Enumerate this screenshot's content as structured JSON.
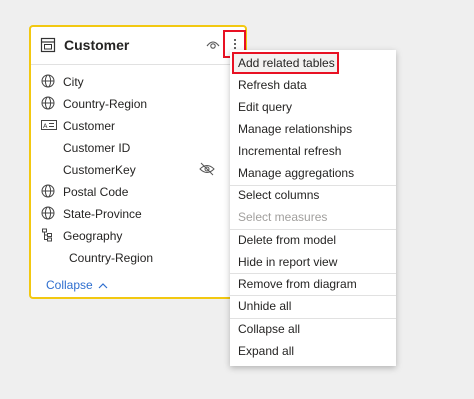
{
  "card": {
    "title": "Customer",
    "fields": [
      {
        "label": "City",
        "icon": "globe-icon"
      },
      {
        "label": "Country-Region",
        "icon": "globe-icon"
      },
      {
        "label": "Customer",
        "icon": "text-field-icon"
      },
      {
        "label": "Customer ID",
        "icon": ""
      },
      {
        "label": "CustomerKey",
        "icon": "",
        "hidden": true
      },
      {
        "label": "Postal Code",
        "icon": "globe-icon"
      },
      {
        "label": "State-Province",
        "icon": "globe-icon"
      },
      {
        "label": "Geography",
        "icon": "hierarchy-icon"
      },
      {
        "label": "Country-Region",
        "icon": "",
        "indent": true
      }
    ],
    "collapse_label": "Collapse"
  },
  "menu": {
    "items": [
      {
        "label": "Add related tables",
        "highlighted": true
      },
      {
        "label": "Refresh data"
      },
      {
        "label": "Edit query"
      },
      {
        "label": "Manage relationships"
      },
      {
        "label": "Incremental refresh"
      },
      {
        "label": "Manage aggregations"
      },
      {
        "label": "Select columns"
      },
      {
        "label": "Select measures",
        "disabled": true
      },
      {
        "label": "Delete from model"
      },
      {
        "label": "Hide in report view"
      },
      {
        "label": "Remove from diagram"
      },
      {
        "label": "Unhide all"
      },
      {
        "label": "Collapse all"
      },
      {
        "label": "Expand all"
      }
    ]
  },
  "colors": {
    "card_border": "#f2c811",
    "highlight_border": "#e81123",
    "link": "#2f6fcf"
  }
}
